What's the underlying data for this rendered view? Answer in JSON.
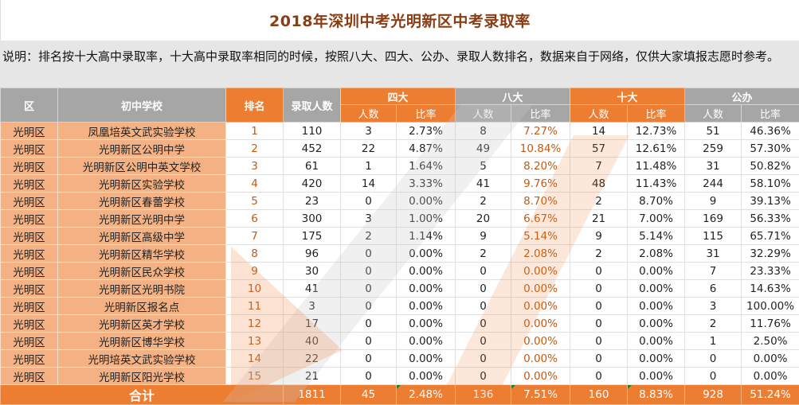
{
  "title": "2018年深圳中考光明新区中考录取率",
  "note": "说明：排名按十大高中录取率，十大高中录取率相同的时候，按照八大、四大、公办、录取人数排名，数据来自于网络，仅供大家填报志愿时参考。",
  "colors": {
    "header_orange": "#ed7d31",
    "header_grey": "#a6a6a6",
    "school_fill": "#f4b183",
    "rank_text": "#c65911",
    "title_text": "#8a3d12"
  },
  "headers": {
    "district": "区",
    "school": "初中学校",
    "rank": "排名",
    "admitted": "录取人数",
    "groups": [
      "四大",
      "八大",
      "十大",
      "公办"
    ],
    "sub_count": "人数",
    "sub_rate": "比率"
  },
  "rows": [
    {
      "district": "光明区",
      "school": "凤凰培英文武实验学校",
      "rank": "1",
      "admitted": "110",
      "g4": "3",
      "g4r": "2.73%",
      "g8": "8",
      "g8r": "7.27%",
      "g10": "14",
      "g10r": "12.73%",
      "pub": "51",
      "pubr": "46.36%"
    },
    {
      "district": "光明区",
      "school": "光明新区公明中学",
      "rank": "2",
      "admitted": "452",
      "g4": "22",
      "g4r": "4.87%",
      "g8": "49",
      "g8r": "10.84%",
      "g10": "57",
      "g10r": "12.61%",
      "pub": "259",
      "pubr": "57.30%"
    },
    {
      "district": "光明区",
      "school": "光明新区公明中英文学校",
      "rank": "3",
      "admitted": "61",
      "g4": "1",
      "g4r": "1.64%",
      "g8": "5",
      "g8r": "8.20%",
      "g10": "7",
      "g10r": "11.48%",
      "pub": "31",
      "pubr": "50.82%"
    },
    {
      "district": "光明区",
      "school": "光明新区实验学校",
      "rank": "4",
      "admitted": "420",
      "g4": "14",
      "g4r": "3.33%",
      "g8": "41",
      "g8r": "9.76%",
      "g10": "48",
      "g10r": "11.43%",
      "pub": "244",
      "pubr": "58.10%"
    },
    {
      "district": "光明区",
      "school": "光明新区春蕾学校",
      "rank": "5",
      "admitted": "23",
      "g4": "0",
      "g4r": "0.00%",
      "g8": "2",
      "g8r": "8.70%",
      "g10": "2",
      "g10r": "8.70%",
      "pub": "9",
      "pubr": "39.13%"
    },
    {
      "district": "光明区",
      "school": "光明新区光明中学",
      "rank": "6",
      "admitted": "300",
      "g4": "3",
      "g4r": "1.00%",
      "g8": "20",
      "g8r": "6.67%",
      "g10": "21",
      "g10r": "7.00%",
      "pub": "169",
      "pubr": "56.33%"
    },
    {
      "district": "光明区",
      "school": "光明新区高级中学",
      "rank": "7",
      "admitted": "175",
      "g4": "2",
      "g4r": "1.14%",
      "g8": "9",
      "g8r": "5.14%",
      "g10": "9",
      "g10r": "5.14%",
      "pub": "115",
      "pubr": "65.71%"
    },
    {
      "district": "光明区",
      "school": "光明新区精华学校",
      "rank": "8",
      "admitted": "96",
      "g4": "0",
      "g4r": "0.00%",
      "g8": "2",
      "g8r": "2.08%",
      "g10": "2",
      "g10r": "2.08%",
      "pub": "31",
      "pubr": "32.29%"
    },
    {
      "district": "光明区",
      "school": "光明新区民众学校",
      "rank": "9",
      "admitted": "30",
      "g4": "0",
      "g4r": "0.00%",
      "g8": "0",
      "g8r": "0.00%",
      "g10": "0",
      "g10r": "0.00%",
      "pub": "7",
      "pubr": "23.33%"
    },
    {
      "district": "光明区",
      "school": "光明新区光明书院",
      "rank": "10",
      "admitted": "41",
      "g4": "0",
      "g4r": "0.00%",
      "g8": "0",
      "g8r": "0.00%",
      "g10": "0",
      "g10r": "0.00%",
      "pub": "6",
      "pubr": "14.63%"
    },
    {
      "district": "光明区",
      "school": "光明新区报名点",
      "rank": "11",
      "admitted": "3",
      "g4": "0",
      "g4r": "0.00%",
      "g8": "0",
      "g8r": "0.00%",
      "g10": "0",
      "g10r": "0.00%",
      "pub": "3",
      "pubr": "100.00%"
    },
    {
      "district": "光明区",
      "school": "光明新区英才学校",
      "rank": "12",
      "admitted": "17",
      "g4": "0",
      "g4r": "0.00%",
      "g8": "0",
      "g8r": "0.00%",
      "g10": "0",
      "g10r": "0.00%",
      "pub": "2",
      "pubr": "11.76%"
    },
    {
      "district": "光明区",
      "school": "光明新区博华学校",
      "rank": "13",
      "admitted": "40",
      "g4": "0",
      "g4r": "0.00%",
      "g8": "0",
      "g8r": "0.00%",
      "g10": "0",
      "g10r": "0.00%",
      "pub": "1",
      "pubr": "2.50%"
    },
    {
      "district": "光明区",
      "school": "光明培英文武实验学校",
      "rank": "14",
      "admitted": "22",
      "g4": "0",
      "g4r": "0.00%",
      "g8": "0",
      "g8r": "0.00%",
      "g10": "0",
      "g10r": "0.00%",
      "pub": "0",
      "pubr": "0.00%"
    },
    {
      "district": "光明区",
      "school": "光明新区阳光学校",
      "rank": "15",
      "admitted": "21",
      "g4": "0",
      "g4r": "0.00%",
      "g8": "0",
      "g8r": "0.00%",
      "g10": "0",
      "g10r": "0.00%",
      "pub": "0",
      "pubr": "0.00%"
    }
  ],
  "total": {
    "label": "合计",
    "admitted": "1811",
    "g4": "45",
    "g4r": "2.48%",
    "g8": "136",
    "g8r": "7.51%",
    "g10": "160",
    "g10r": "8.83%",
    "pub": "928",
    "pubr": "51.24%"
  }
}
